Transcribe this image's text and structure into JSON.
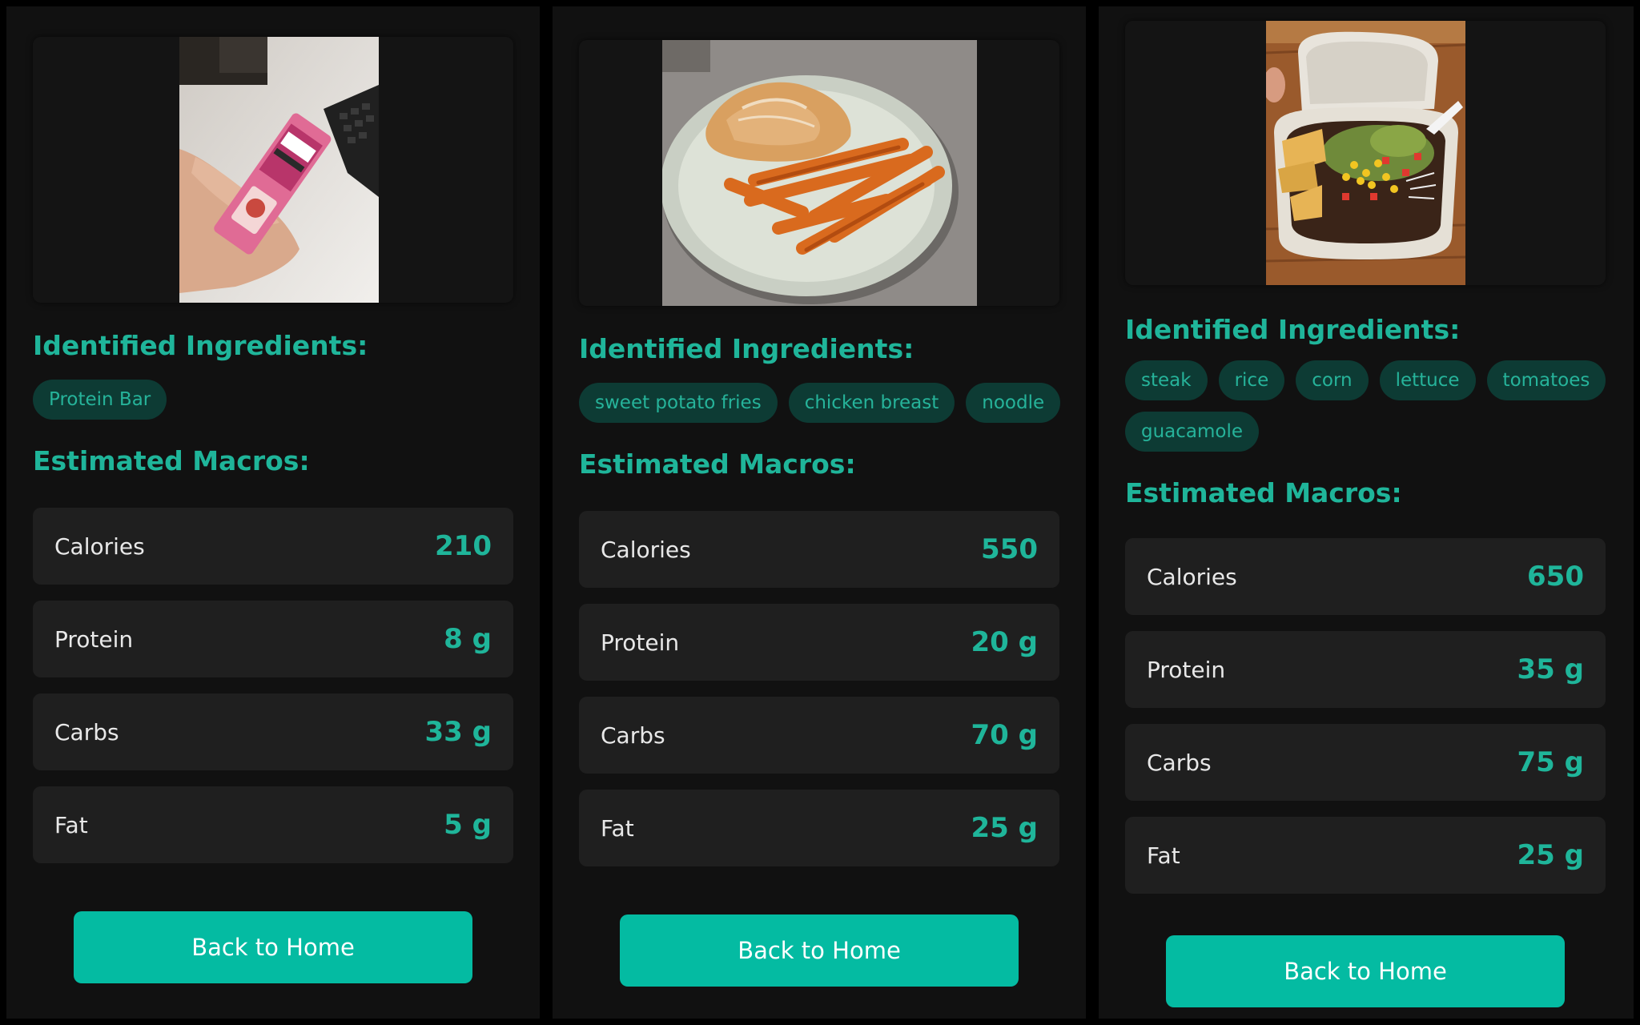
{
  "screens": [
    {
      "photo_icon": "protein-bar-photo",
      "ingredients_title": "Identified Ingredients:",
      "ingredients": [
        "Protein Bar"
      ],
      "macros_title": "Estimated Macros:",
      "macros": [
        {
          "label": "Calories",
          "value": "210"
        },
        {
          "label": "Protein",
          "value": "8 g"
        },
        {
          "label": "Carbs",
          "value": "33 g"
        },
        {
          "label": "Fat",
          "value": "5 g"
        }
      ],
      "back_label": "Back to Home"
    },
    {
      "photo_icon": "chicken-fries-plate-photo",
      "ingredients_title": "Identified Ingredients:",
      "ingredients": [
        "sweet potato fries",
        "chicken breast",
        "noodle"
      ],
      "macros_title": "Estimated Macros:",
      "macros": [
        {
          "label": "Calories",
          "value": "550"
        },
        {
          "label": "Protein",
          "value": "20 g"
        },
        {
          "label": "Carbs",
          "value": "70 g"
        },
        {
          "label": "Fat",
          "value": "25 g"
        }
      ],
      "back_label": "Back to Home"
    },
    {
      "photo_icon": "burrito-bowl-photo",
      "ingredients_title": "Identified Ingredients:",
      "ingredients": [
        "steak",
        "rice",
        "corn",
        "lettuce",
        "tomatoes",
        "guacamole"
      ],
      "macros_title": "Estimated Macros:",
      "macros": [
        {
          "label": "Calories",
          "value": "650"
        },
        {
          "label": "Protein",
          "value": "35 g"
        },
        {
          "label": "Carbs",
          "value": "75 g"
        },
        {
          "label": "Fat",
          "value": "25 g"
        }
      ],
      "back_label": "Back to Home"
    }
  ],
  "colors": {
    "accent": "#1fb59a",
    "button": "#04bba2",
    "chip_bg": "#0d3b34",
    "card_bg": "#1f1f1f",
    "panel_bg": "#111111"
  }
}
